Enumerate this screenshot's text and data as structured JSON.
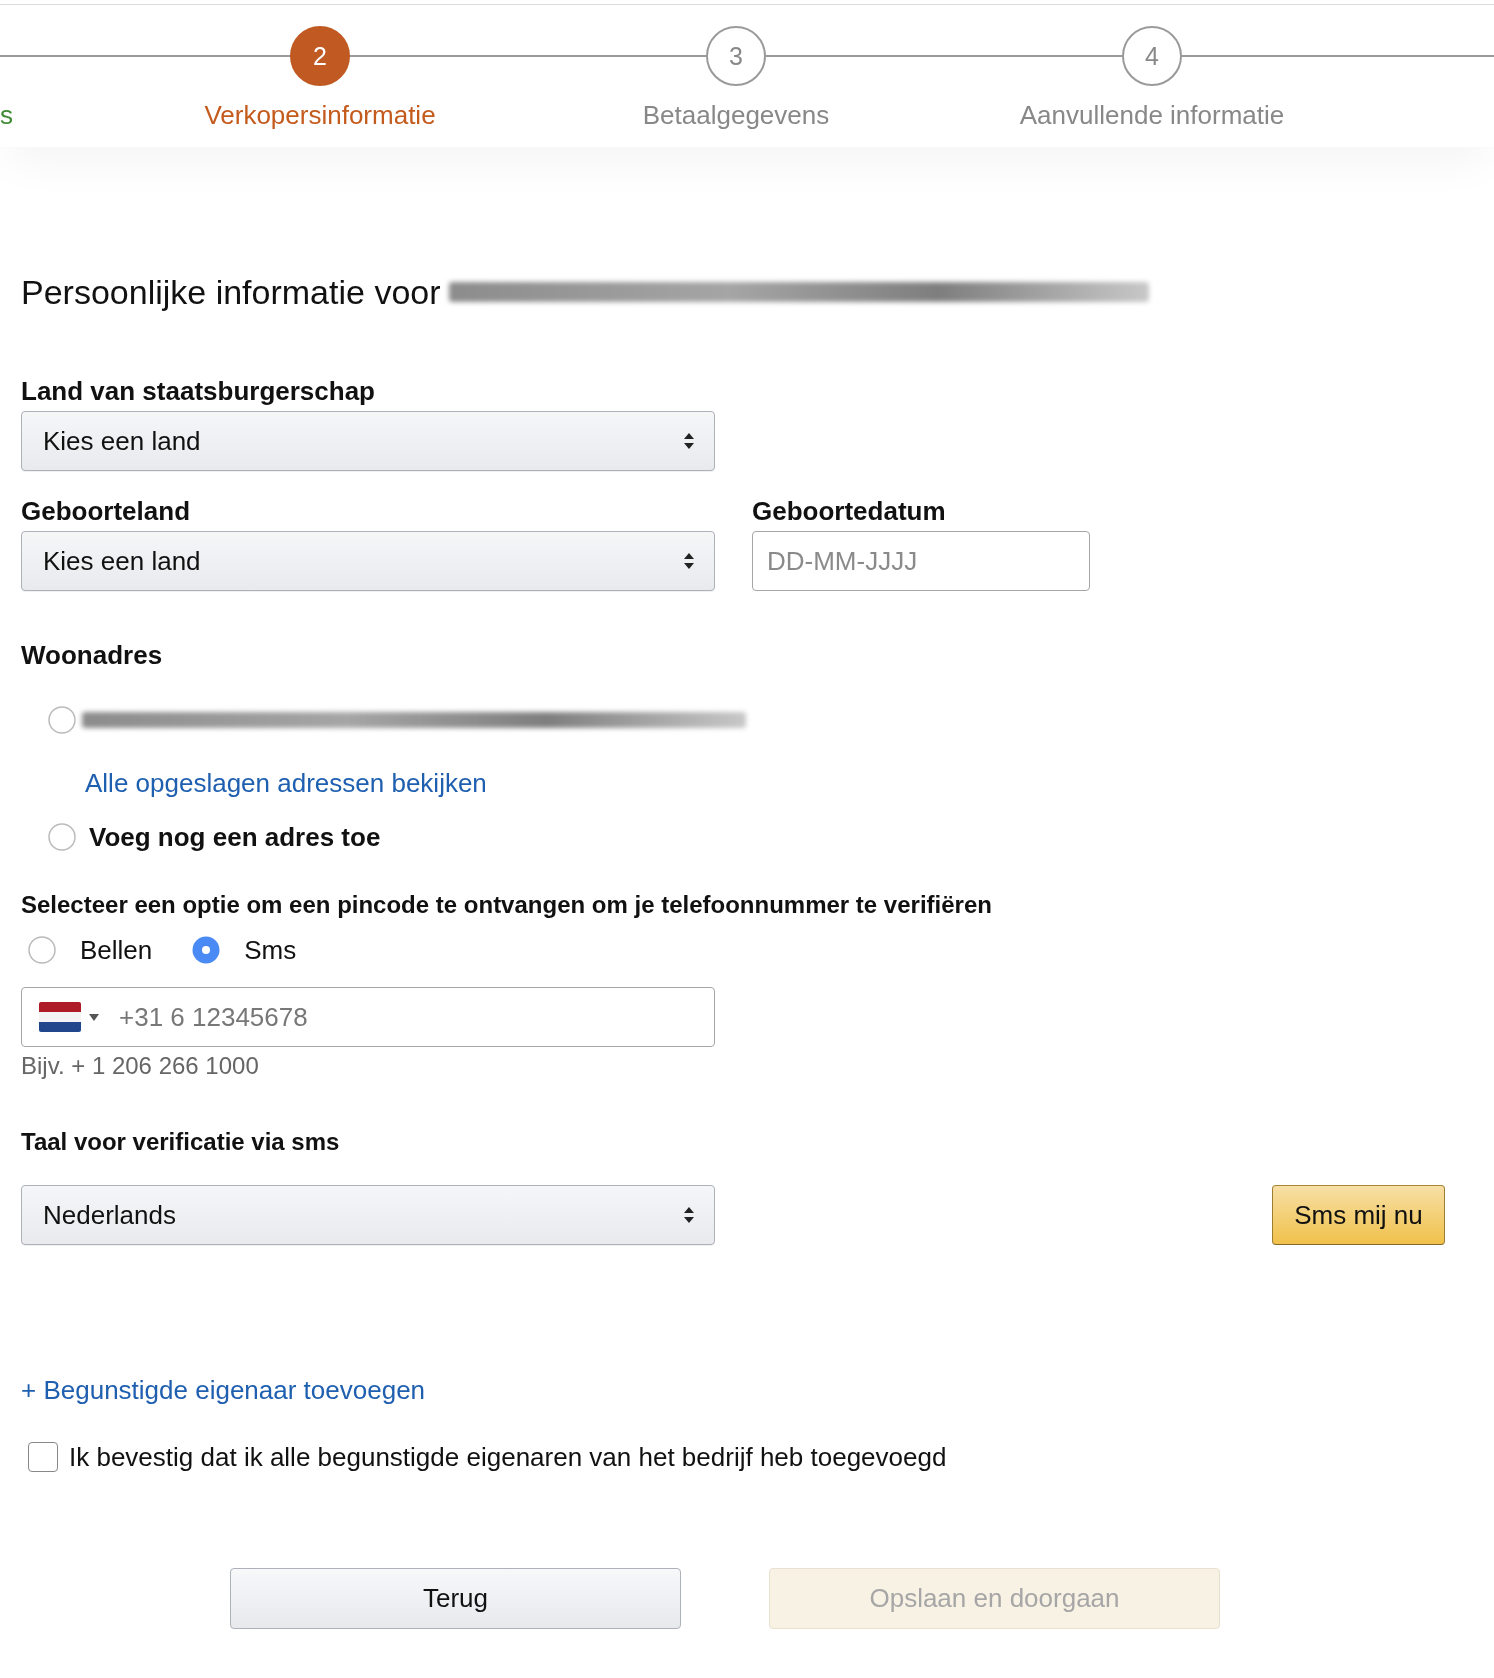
{
  "stepper": {
    "steps": [
      {
        "label": "s",
        "completed": true,
        "selected": false
      },
      {
        "number": "2",
        "label": "Verkopersinformatie",
        "completed": false,
        "selected": true
      },
      {
        "number": "3",
        "label": "Betaalgegevens",
        "completed": false,
        "selected": false
      },
      {
        "number": "4",
        "label": "Aanvullende informatie",
        "completed": false,
        "selected": false
      }
    ]
  },
  "heading": {
    "text": "Persoonlijke informatie voor",
    "name_redacted": true
  },
  "citizenship": {
    "label": "Land van staatsburgerschap",
    "value": "Kies een land"
  },
  "birth_country": {
    "label": "Geboorteland",
    "value": "Kies een land"
  },
  "birth_date": {
    "label": "Geboortedatum",
    "placeholder": "DD-MM-JJJJ"
  },
  "address": {
    "title": "Woonadres",
    "saved_address": {
      "redacted": true,
      "selected": false
    },
    "view_all_link": "Alle opgeslagen adressen bekijken",
    "new_address": {
      "label": "Voeg nog een adres toe",
      "selected": false
    }
  },
  "verification": {
    "prompt": "Selecteer een optie om een pincode te ontvangen om je telefoonnummer te verifiëren",
    "methods": [
      {
        "label": "Bellen",
        "selected": false
      },
      {
        "label": "Sms",
        "selected": true
      }
    ],
    "phone": {
      "placeholder": "+31 6 12345678",
      "hint": "Bijv. + 1 206 266 1000"
    },
    "language": {
      "label": "Taal voor verificatie via sms",
      "value": "Nederlands"
    },
    "send_button": {
      "label": "Sms mij nu"
    }
  },
  "beneficial_owner_link": "+ Begunstigde eigenaar toevoegen",
  "confirmation": {
    "label": "Ik bevestig dat ik alle begunstigde eigenaren van het bedrijf heb toegevoegd",
    "checked": false
  },
  "buttons": [
    {
      "label": "Terug",
      "disabled": false
    },
    {
      "label": "Opslaan en doorgaan",
      "disabled": true
    }
  ]
}
